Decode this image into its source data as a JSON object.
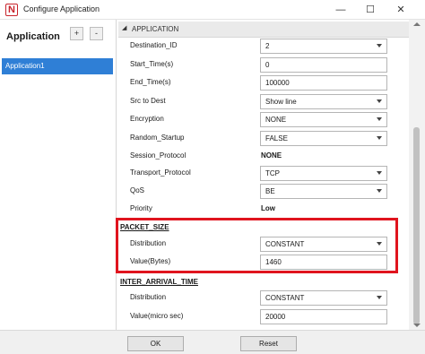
{
  "window": {
    "title": "Configure Application",
    "logo_letter": "N",
    "minimize": "—",
    "maximize": "☐",
    "close": "✕"
  },
  "sidebar": {
    "header": "Application",
    "add_label": "+",
    "remove_label": "-",
    "items": [
      {
        "label": "Application1",
        "selected": true
      }
    ]
  },
  "section": {
    "arrow": "◢",
    "label": "APPLICATION"
  },
  "properties": {
    "destination_id": {
      "label": "Destination_ID",
      "value": "2"
    },
    "start_time": {
      "label": "Start_Time(s)",
      "value": "0"
    },
    "end_time": {
      "label": "End_Time(s)",
      "value": "100000"
    },
    "src_to_dest": {
      "label": "Src to Dest",
      "value": "Show line"
    },
    "encryption": {
      "label": "Encryption",
      "value": "NONE"
    },
    "random_startup": {
      "label": "Random_Startup",
      "value": "FALSE"
    },
    "session_protocol": {
      "label": "Session_Protocol",
      "value": "NONE"
    },
    "transport_protocol": {
      "label": "Transport_Protocol",
      "value": "TCP"
    },
    "qos": {
      "label": "QoS",
      "value": "BE"
    },
    "priority": {
      "label": "Priority",
      "value": "Low"
    }
  },
  "packet_size": {
    "title": "PACKET_SIZE",
    "distribution": {
      "label": "Distribution",
      "value": "CONSTANT"
    },
    "value": {
      "label": "Value(Bytes)",
      "value": "1460"
    }
  },
  "inter_arrival_time": {
    "title": "INTER_ARRIVAL_TIME",
    "distribution": {
      "label": "Distribution",
      "value": "CONSTANT"
    },
    "value": {
      "label": "Value(micro sec)",
      "value": "20000"
    }
  },
  "footer": {
    "ok_label": "OK",
    "reset_label": "Reset"
  },
  "colors": {
    "selection": "#2f7fd6",
    "highlight_border": "#e0141e",
    "logo": "#c8242c"
  }
}
